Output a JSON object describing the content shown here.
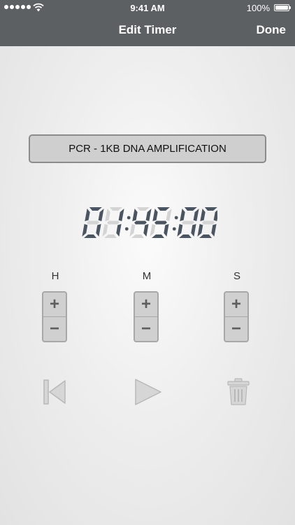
{
  "status_bar": {
    "time": "9:41 AM",
    "battery_percent": "100%",
    "signal_icon": "signal-dots-icon",
    "wifi_icon": "wifi-icon",
    "battery_icon": "battery-icon"
  },
  "nav": {
    "title": "Edit Timer",
    "done_label": "Done"
  },
  "timer": {
    "name": "PCR - 1KB DNA AMPLIFICATION",
    "display": "01:45:00",
    "hours": "01",
    "minutes": "45",
    "seconds": "00"
  },
  "steppers": [
    {
      "unit": "H",
      "plus": "+",
      "minus": "−"
    },
    {
      "unit": "M",
      "plus": "+",
      "minus": "−"
    },
    {
      "unit": "S",
      "plus": "+",
      "minus": "−"
    }
  ],
  "controls": {
    "reset_icon": "skip-to-start-icon",
    "play_icon": "play-icon",
    "delete_icon": "trash-icon"
  },
  "colors": {
    "header_bg": "#5d6063",
    "lcd_digit": "#4a5561",
    "lcd_ghost": "#d4d4d4",
    "disabled_icon": "#bdbdbd"
  }
}
